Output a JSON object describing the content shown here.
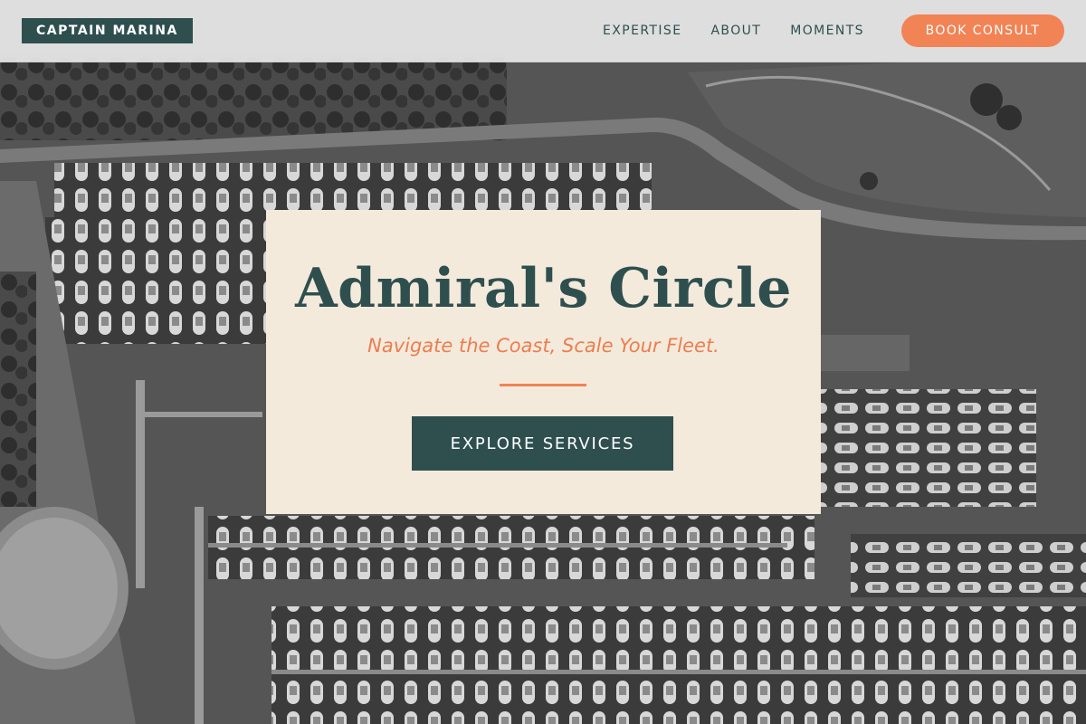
{
  "brand": {
    "name": "CAPTAIN MARINA"
  },
  "nav": {
    "items": [
      {
        "label": "EXPERTISE"
      },
      {
        "label": "ABOUT"
      },
      {
        "label": "MOMENTS"
      }
    ],
    "cta_label": "BOOK CONSULT"
  },
  "hero": {
    "title": "Admiral's Circle",
    "subtitle": "Navigate the Coast, Scale Your Fleet.",
    "button_label": "EXPLORE SERVICES",
    "image_description_icon": "aerial-marina-photo"
  },
  "colors": {
    "primary": "#2f4f4f",
    "accent": "#f28354",
    "card_background": "#f3eadc",
    "header_background": "#e8e8e8"
  }
}
